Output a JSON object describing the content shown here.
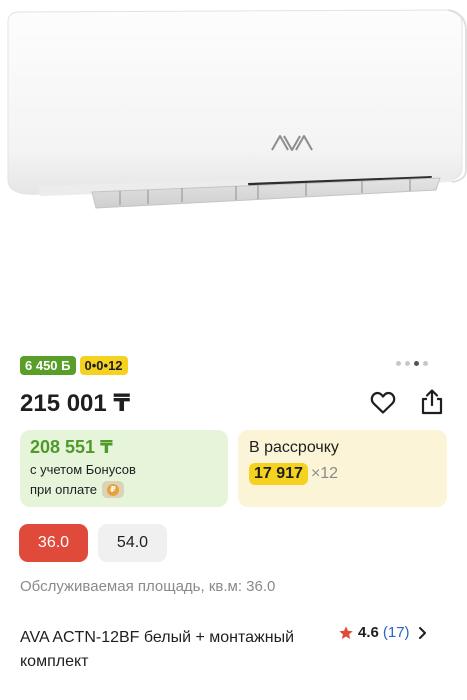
{
  "product_image": {
    "brand_logo": "AVA",
    "alt": "air-conditioner-indoor-unit-image"
  },
  "badges": {
    "bonus": "6 450 Б",
    "installment": "0•0•12"
  },
  "gallery": {
    "total": 4,
    "active": 3
  },
  "price": "215 001 ₸",
  "actions": {
    "favorite_icon": "heart-outline-icon",
    "share_icon": "share-icon"
  },
  "bonus_card": {
    "price": "208 551 ₸",
    "line1": "с учетом Бонусов",
    "line2": "при оплате"
  },
  "installment_card": {
    "title": "В рассрочку",
    "amount": "17 917",
    "months": "×12"
  },
  "area_options": {
    "selected": "36.0",
    "other": "54.0"
  },
  "area_label": "Обслуживаемая площадь, кв.м: 36.0",
  "product_title": "AVA ACTN-12BF белый + монтажный комплект",
  "rating": {
    "value": "4.6",
    "count": "(17)",
    "star_color": "#e04a3b"
  },
  "colors": {
    "bonus_green": "#5a9e2a",
    "installment_yellow": "#f5d21f",
    "selected_red": "#e04a3b",
    "link_blue": "#2b64c7"
  }
}
